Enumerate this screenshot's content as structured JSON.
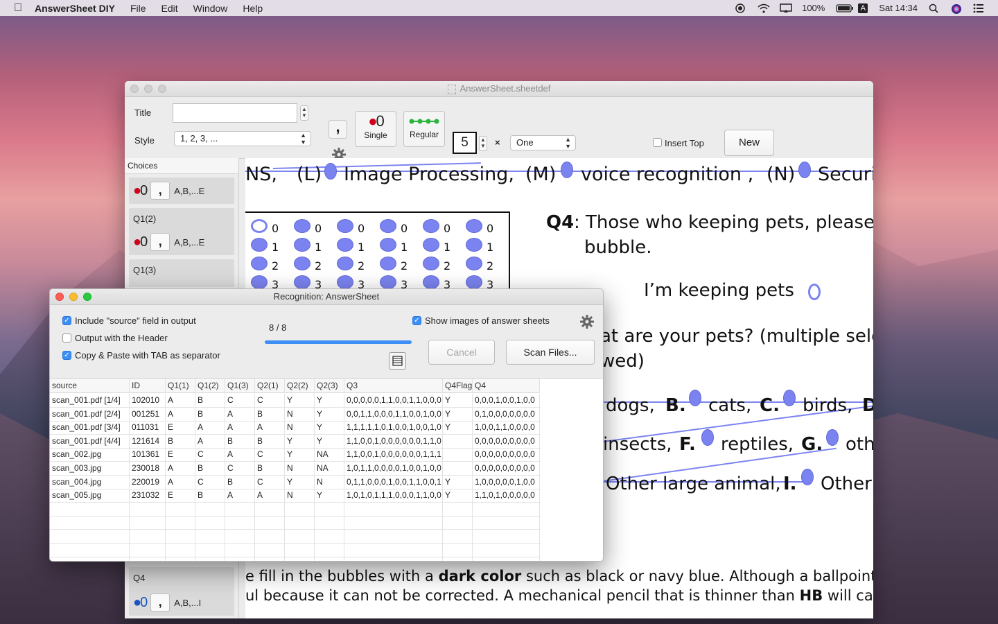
{
  "menubar": {
    "app_name": "AnswerSheet DIY",
    "menus": [
      "File",
      "Edit",
      "Window",
      "Help"
    ],
    "battery": "100%",
    "clock": "Sat 14:34",
    "input_source": "A"
  },
  "main_window": {
    "title": "AnswerSheet.sheetdef",
    "toolbar": {
      "title_label": "Title",
      "title_value": "",
      "style_label": "Style",
      "style_value": "1, 2, 3, ...",
      "separator_glyph": ",",
      "single_label": "Single",
      "regular_label": "Regular",
      "count_value": "5",
      "times_symbol": "×",
      "repeat_value": "One",
      "insert_top_label": "Insert Top",
      "new_button": "New"
    },
    "choices_panel": {
      "header": "Choices",
      "items": [
        {
          "name": "",
          "style": "red",
          "separator": ",",
          "range": "A,B,...E"
        },
        {
          "name": "Q1(2)",
          "style": "red",
          "separator": ",",
          "range": "A,B,...E"
        },
        {
          "name": "Q1(3)",
          "style": "red",
          "separator": ",",
          "range": ""
        },
        {
          "name": "Q4",
          "style": "blue",
          "separator": ",",
          "range": "A,B,...I"
        }
      ]
    },
    "sheet": {
      "top_line": {
        "a": "NS,",
        "b": "(L)",
        "c": "Image Processing,",
        "d": "(M)",
        "e": "voice recognition ,",
        "f": "(N)",
        "g": "Securi"
      },
      "digit_labels": [
        "0",
        "1",
        "2",
        "3"
      ],
      "q4_label": "Q4",
      "q4_text_1": ": Those who keeping pets, please fi",
      "q4_text_2": "bubble.",
      "keeping_pets": "I’m keeping pets",
      "pets_question_1": "at are your pets? (multiple selec",
      "pets_question_2": "wed)",
      "row1": {
        "t1": "dogs,",
        "l1": "B.",
        "t2": "cats,",
        "l2": "C.",
        "t3": "birds,",
        "l3": "D"
      },
      "row2": {
        "t1": "insects,",
        "l1": "F.",
        "t2": "reptiles,",
        "l2": "G.",
        "t3": "oth"
      },
      "row3": {
        "t1": "Other large animal,",
        "l1": "I.",
        "t2": "Other"
      },
      "footer_1a": "e fill in the bubbles with a ",
      "footer_1b": "dark color",
      "footer_1c": " such as black or navy blue. Although a ballpoint pen is",
      "footer_2a": "ul because it can not be corrected. A mechanical pencil that is thinner than ",
      "footer_2b": "HB",
      "footer_2c": " will cause fals"
    }
  },
  "recognition_window": {
    "title": "Recognition: AnswerSheet",
    "options": [
      {
        "label": "Include \"source\" field in output",
        "checked": true
      },
      {
        "label": "Output with the Header",
        "checked": false
      },
      {
        "label": "Copy & Paste with TAB as separator",
        "checked": true
      }
    ],
    "progress_text": "8 / 8",
    "progress": 1.0,
    "show_images_label": "Show images of answer sheets",
    "show_images_checked": true,
    "cancel_button": "Cancel",
    "scan_button": "Scan Files...",
    "table": {
      "columns": [
        "source",
        "ID",
        "Q1(1)",
        "Q1(2)",
        "Q1(3)",
        "Q2(1)",
        "Q2(2)",
        "Q2(3)",
        "Q3",
        "Q4Flag",
        "Q4"
      ],
      "rows": [
        [
          "scan_001.pdf [1/4]",
          "102010",
          "A",
          "B",
          "C",
          "C",
          "Y",
          "Y",
          "0,0,0,0,0,1,1,0,0,1,1,0,0,0",
          "Y",
          "0,0,0,1,0,0,1,0,0"
        ],
        [
          "scan_001.pdf [2/4]",
          "001251",
          "A",
          "B",
          "A",
          "B",
          "N",
          "Y",
          "0,0,1,1,0,0,0,1,1,0,0,1,0,0",
          "Y",
          "0,1,0,0,0,0,0,0,0"
        ],
        [
          "scan_001.pdf [3/4]",
          "011031",
          "E",
          "A",
          "A",
          "A",
          "N",
          "Y",
          "1,1,1,1,1,0,1,0,0,1,0,0,1,0",
          "Y",
          "1,0,0,1,1,0,0,0,0"
        ],
        [
          "scan_001.pdf [4/4]",
          "121614",
          "B",
          "A",
          "B",
          "B",
          "Y",
          "Y",
          "1,1,0,0,1,0,0,0,0,0,0,1,1,0",
          "",
          "0,0,0,0,0,0,0,0,0"
        ],
        [
          "scan_002.jpg",
          "101361",
          "E",
          "C",
          "A",
          "C",
          "Y",
          "NA",
          "1,1,0,0,1,0,0,0,0,0,0,1,1,1",
          "",
          "0,0,0,0,0,0,0,0,0"
        ],
        [
          "scan_003.jpg",
          "230018",
          "A",
          "B",
          "C",
          "B",
          "N",
          "NA",
          "1,0,1,1,0,0,0,0,1,0,0,1,0,0",
          "",
          "0,0,0,0,0,0,0,0,0"
        ],
        [
          "scan_004.jpg",
          "220019",
          "A",
          "C",
          "B",
          "C",
          "Y",
          "N",
          "0,1,1,0,0,0,1,0,0,1,1,0,0,1",
          "Y",
          "1,0,0,0,0,0,1,0,0"
        ],
        [
          "scan_005.jpg",
          "231032",
          "E",
          "B",
          "A",
          "A",
          "N",
          "Y",
          "1,0,1,0,1,1,1,0,0,0,1,1,0,0",
          "Y",
          "1,1,0,1,0,0,0,0,0"
        ]
      ]
    }
  },
  "colors": {
    "bubble": "#7b83f0",
    "accent": "#3d8ff5",
    "mark_red": "#d0021b"
  }
}
